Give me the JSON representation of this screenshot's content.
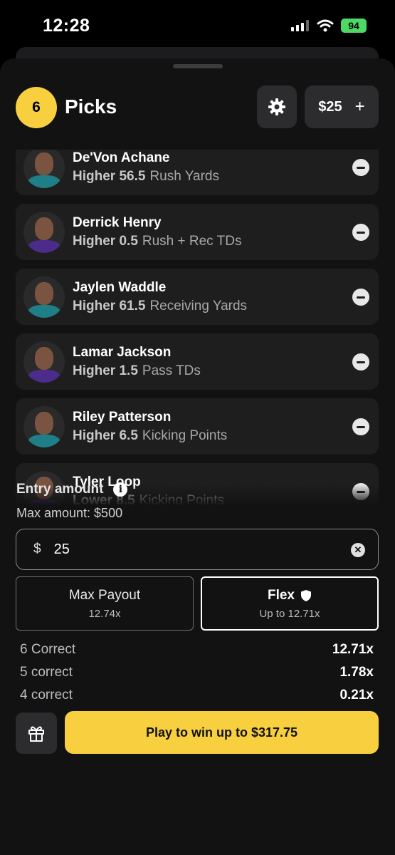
{
  "status_bar": {
    "time": "12:28",
    "battery": "94"
  },
  "header": {
    "pick_count": "6",
    "title": "Picks",
    "amount": "$25",
    "plus": "+"
  },
  "picks": [
    {
      "name": "De'Von Achane",
      "direction": "Higher",
      "line": "56.5",
      "stat": "Rush Yards",
      "jersey_color": "#1f7f86"
    },
    {
      "name": "Derrick Henry",
      "direction": "Higher",
      "line": "0.5",
      "stat": "Rush + Rec TDs",
      "jersey_color": "#4b2c8a"
    },
    {
      "name": "Jaylen Waddle",
      "direction": "Higher",
      "line": "61.5",
      "stat": "Receiving Yards",
      "jersey_color": "#1f7f86"
    },
    {
      "name": "Lamar Jackson",
      "direction": "Higher",
      "line": "1.5",
      "stat": "Pass TDs",
      "jersey_color": "#4b2c8a"
    },
    {
      "name": "Riley Patterson",
      "direction": "Higher",
      "line": "6.5",
      "stat": "Kicking Points",
      "jersey_color": "#1f7f86"
    },
    {
      "name": "Tyler Loop",
      "direction": "Lower",
      "line": "8.5",
      "stat": "Kicking Points",
      "jersey_color": "#4b2c8a"
    }
  ],
  "entry": {
    "label": "Entry amount",
    "info_glyph": "i",
    "max_amount": "Max amount: $500",
    "currency": "$",
    "value": "25"
  },
  "modes": {
    "max_payout": {
      "title": "Max Payout",
      "subtitle": "12.74x"
    },
    "flex": {
      "title": "Flex",
      "subtitle": "Up to 12.71x"
    }
  },
  "payouts": [
    {
      "label": "6 Correct",
      "multiplier": "12.71x"
    },
    {
      "label": "5 correct",
      "multiplier": "1.78x"
    },
    {
      "label": "4 correct",
      "multiplier": "0.21x"
    }
  ],
  "cta": {
    "play_label": "Play to win up to $317.75"
  },
  "colors": {
    "accent": "#f8d03f",
    "sheet_bg": "#121212",
    "card_bg": "#1e1e1e"
  }
}
